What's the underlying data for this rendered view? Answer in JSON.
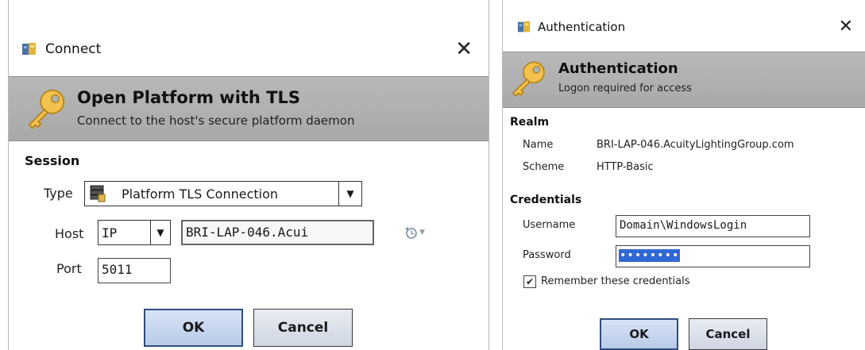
{
  "connect_dialog": {
    "title": "Connect",
    "close_icon": "close-icon",
    "header": {
      "title": "Open Platform with TLS",
      "subtitle": "Connect to the host's secure platform daemon",
      "icon": "key-icon"
    },
    "session": {
      "section_title": "Session",
      "type_label": "Type",
      "type_value": "Platform TLS Connection",
      "host_label": "Host",
      "host_mode": "IP",
      "host_value": "BRI-LAP-046.Acui",
      "port_label": "Port",
      "port_value": "5011",
      "history_icon": "history-icon"
    },
    "buttons": {
      "ok": "OK",
      "cancel": "Cancel"
    }
  },
  "auth_dialog": {
    "title": "Authentication",
    "close_icon": "close-icon",
    "header": {
      "title": "Authentication",
      "subtitle": "Logon required for access",
      "icon": "key-icon"
    },
    "realm": {
      "section_title": "Realm",
      "name_label": "Name",
      "name_value": "BRI-LAP-046.AcuityLightingGroup.com",
      "scheme_label": "Scheme",
      "scheme_value": "HTTP-Basic"
    },
    "credentials": {
      "section_title": "Credentials",
      "username_label": "Username",
      "username_value": "Domain\\WindowsLogin",
      "password_label": "Password",
      "password_masked": "••••••••",
      "remember_label": "Remember these credentials",
      "remember_checked": true
    },
    "buttons": {
      "ok": "OK",
      "cancel": "Cancel"
    }
  },
  "colors": {
    "header_bg": "#b0b0b0",
    "primary_button": "#b9cbe8",
    "selection": "#3168d6"
  }
}
